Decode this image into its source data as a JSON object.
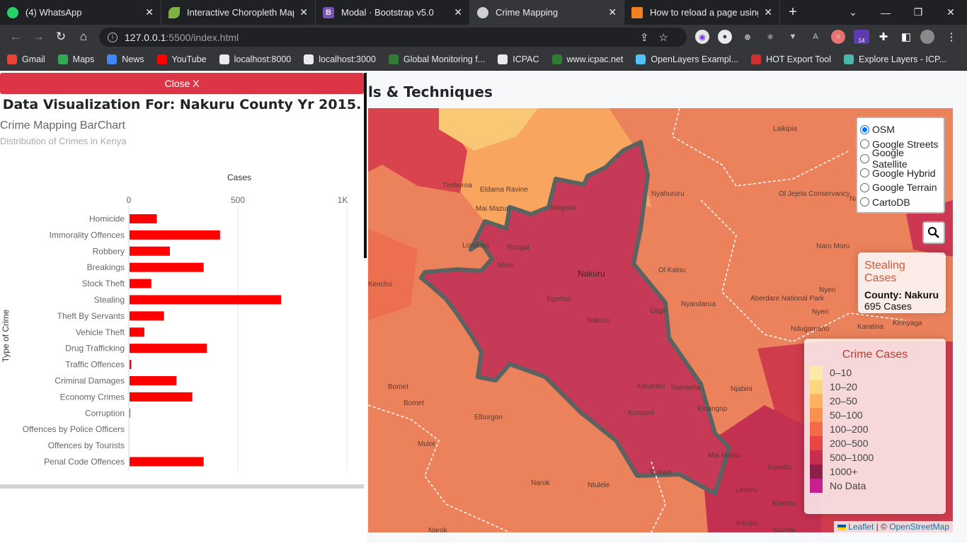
{
  "browser": {
    "tabs": [
      {
        "label": "(4) WhatsApp",
        "icon": "whatsapp-icon",
        "color": "#25d366",
        "active": false
      },
      {
        "label": "Interactive Choropleth Map - ",
        "icon": "leaf-icon",
        "color": "#7cb342",
        "active": false
      },
      {
        "label": "Modal · Bootstrap v5.0",
        "icon": "bootstrap-icon",
        "color": "#7952b3",
        "active": false
      },
      {
        "label": "Crime Mapping",
        "icon": "globe-icon",
        "color": "#cfcfcf",
        "active": true
      },
      {
        "label": "How to reload a page using J",
        "icon": "stackoverflow-icon",
        "color": "#f48024",
        "active": false
      }
    ],
    "url_host": "127.0.0.1",
    "url_path": ":5500/index.html",
    "extension_badge": "14",
    "bookmarks": [
      {
        "label": "Gmail",
        "color": "#ea4335"
      },
      {
        "label": "Maps",
        "color": "#34a853"
      },
      {
        "label": "News",
        "color": "#4285f4"
      },
      {
        "label": "YouTube",
        "color": "#ff0000"
      },
      {
        "label": "localhost:8000",
        "color": "#e8eaed"
      },
      {
        "label": "localhost:3000",
        "color": "#e8eaed"
      },
      {
        "label": "Global Monitoring f...",
        "color": "#2e7d32"
      },
      {
        "label": "ICPAC",
        "color": "#e8eaed"
      },
      {
        "label": "www.icpac.net",
        "color": "#2e7d32"
      },
      {
        "label": "OpenLayers Exampl...",
        "color": "#4fc3f7"
      },
      {
        "label": "HOT Export Tool",
        "color": "#d32f2f"
      },
      {
        "label": "Explore Layers - ICP...",
        "color": "#4db6ac"
      }
    ]
  },
  "page": {
    "headline": "ls & Techniques"
  },
  "panel": {
    "close_label": "Close X",
    "title": "Data Visualization For: Nakuru County Yr 2015.",
    "chart_title": "Crime Mapping BarChart",
    "chart_subtitle": "Distribution of Crimes in Kenya"
  },
  "chart_data": {
    "type": "bar",
    "orientation": "horizontal",
    "title": "Crime Mapping BarChart",
    "subtitle": "Distribution of Crimes in Kenya",
    "xlabel": "Cases",
    "ylabel": "Type of Crime",
    "xlim": [
      0,
      1000
    ],
    "xticks": [
      "0",
      "500",
      "1K"
    ],
    "xtick_values": [
      0,
      500,
      1000
    ],
    "bar_color": "#ff0000",
    "categories": [
      "Homicide",
      "Immorality Offences",
      "Robbery",
      "Breakings",
      "Stock Theft",
      "Stealing",
      "Theft By Servants",
      "Vehicle Theft",
      "Drug Trafficking",
      "Traffic Offences",
      "Criminal Damages",
      "Economy Crimes",
      "Corruption",
      "Offences by Police Officers",
      "Offences by Tourists",
      "Penal Code Offences"
    ],
    "values": [
      125,
      415,
      185,
      340,
      100,
      695,
      158,
      68,
      355,
      8,
      215,
      288,
      3,
      0,
      0,
      340
    ]
  },
  "map": {
    "layer_options": [
      "OSM",
      "Google Streets",
      "Google Satellite",
      "Google Hybrid",
      "Google Terrain",
      "CartoDB"
    ],
    "selected_layer": "OSM",
    "info_title": "Stealing Cases",
    "info_county_label": "County:",
    "info_county": "Nakuru",
    "info_cases": "695 Cases",
    "legend_title": "Crime Cases",
    "legend": [
      {
        "label": "0–10",
        "color": "#fde9a8"
      },
      {
        "label": "10–20",
        "color": "#fcd67f"
      },
      {
        "label": "20–50",
        "color": "#fbb35f"
      },
      {
        "label": "50–100",
        "color": "#f9904f"
      },
      {
        "label": "100–200",
        "color": "#f46a48"
      },
      {
        "label": "200–500",
        "color": "#e74545"
      },
      {
        "label": "500–1000",
        "color": "#c62d4e"
      },
      {
        "label": "1000+",
        "color": "#8e1f4b"
      },
      {
        "label": "No Data",
        "color": "#c71f8f"
      }
    ],
    "place_labels": [
      "Timboroa",
      "Eldama Ravine",
      "Mai Mazuri",
      "Mogotio",
      "Laikipia",
      "Londiani",
      "Rongai",
      "Molo",
      "Nakuru",
      "Ol Kalou",
      "Egerton",
      "Nakuru",
      "Gilgil",
      "Kasarani",
      "Naivasha",
      "Kongoni",
      "Kinangop",
      "Njabini",
      "Bomet",
      "Bomet",
      "Mulot",
      "Suswa",
      "Narok",
      "Ntulele",
      "Mai Mahiu",
      "Limuru",
      "Kiambu",
      "Kiambu",
      "Nyahururu",
      "Ol Jejeta Conservancy",
      "Nanyuki",
      "Nyeri",
      "Nyeri",
      "Ndugamano",
      "Karatina",
      "Kirinyaga",
      "Nyandarua",
      "Aberdare National Park",
      "Narok",
      "Kikuyu",
      "Nairobi",
      "Naro Moru",
      "Kericho",
      "Elburgon"
    ],
    "attribution_leaflet": "Leaflet",
    "attribution_sep": " | © ",
    "attribution_osm": "OpenStreetMap"
  }
}
